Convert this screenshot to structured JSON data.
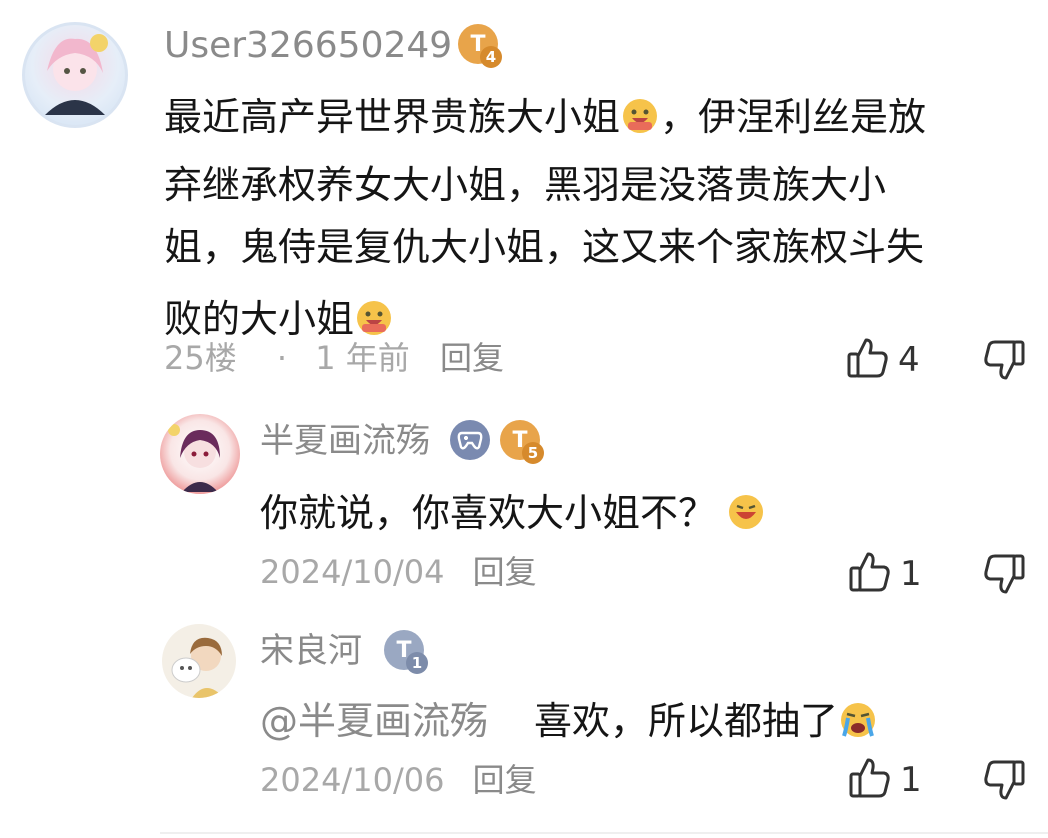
{
  "comment": {
    "username": "User326650249",
    "level": "4",
    "lines": [
      "最近高产异世界贵族大小姐",
      "，伊涅利丝是放",
      "弃继承权养女大小姐，黑羽是没落贵族大小",
      "姐，鬼侍是复仇大小姐，这又来个家族权斗失",
      "败的大小姐"
    ],
    "floor": "25楼",
    "sep": "·",
    "time": "1 年前",
    "reply_label": "回复",
    "likes": "4"
  },
  "replies": [
    {
      "username": "半夏画流殇",
      "level": "5",
      "text": "你就说，你喜欢大小姐不？",
      "date": "2024/10/04",
      "reply_label": "回复",
      "likes": "1"
    },
    {
      "username": "宋良河",
      "level": "1",
      "mention": "@半夏画流殇",
      "text": "喜欢，所以都抽了",
      "date": "2024/10/06",
      "reply_label": "回复",
      "likes": "1"
    }
  ],
  "colors": {
    "badge_gold": "#e8a44a",
    "badge_gray": "#9aa8c2",
    "game_badge": "#7a8ab0"
  },
  "icons": [
    "thumbs-up-icon",
    "thumbs-down-icon",
    "game-controller-icon",
    "grinning-emoji-icon",
    "crying-emoji-icon"
  ]
}
